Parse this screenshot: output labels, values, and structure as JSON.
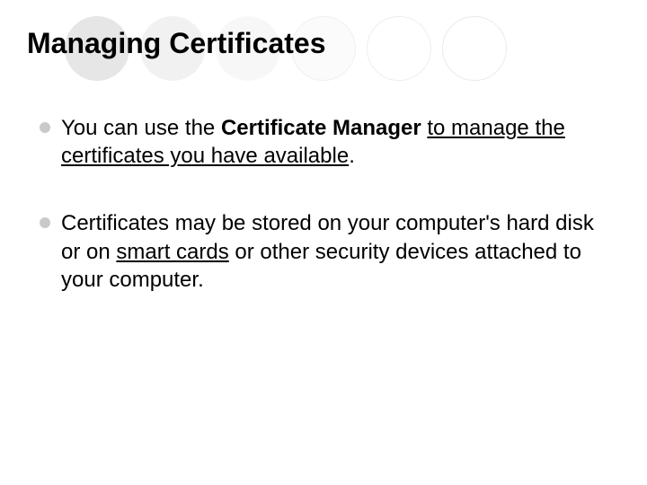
{
  "title": "Managing Certificates",
  "bullets": [
    {
      "pre": "You can use the ",
      "bold": "Certificate Manager",
      "mid": " ",
      "uline": "to manage the certificates you have available",
      "post": "."
    },
    {
      "pre": "Certificates may be stored on your computer's hard disk or on ",
      "uline": "smart cards",
      "post": " or other security devices attached to your computer."
    }
  ]
}
